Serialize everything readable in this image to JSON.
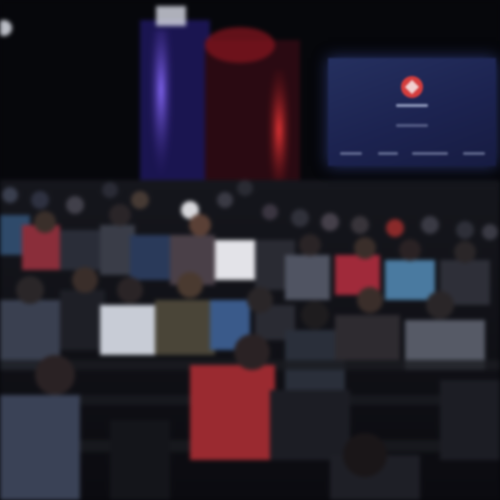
{
  "image": {
    "description_colors": {
      "background": "#07080c",
      "stage_purple": "#6a4cd8",
      "stage_red": "#c8202a",
      "screen_blue": "#1f2754",
      "logo_red": "#d43d3d"
    }
  }
}
